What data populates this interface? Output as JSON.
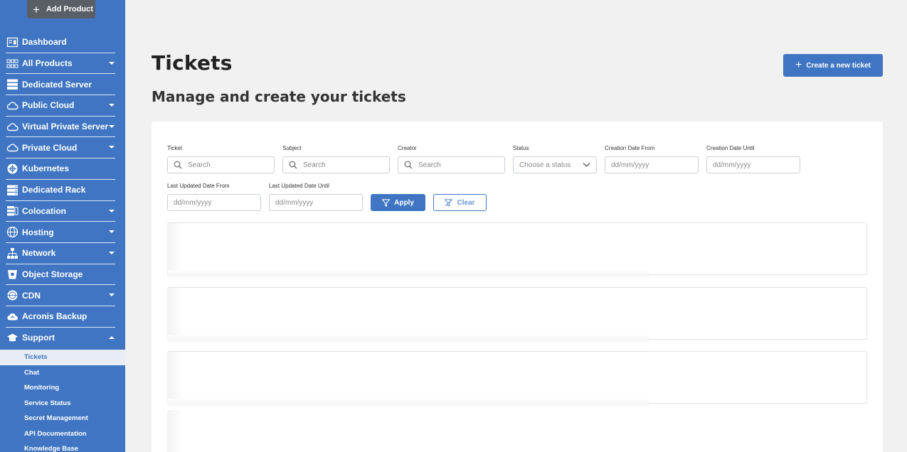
{
  "sidebar": {
    "add_product_label": "Add Product",
    "items": [
      {
        "label": "Dashboard",
        "icon": "dashboard-icon",
        "caret": "none"
      },
      {
        "label": "All Products",
        "icon": "grid-icon",
        "caret": "down"
      },
      {
        "label": "Dedicated Server",
        "icon": "server-icon",
        "caret": "none"
      },
      {
        "label": "Public Cloud",
        "icon": "cloud-icon",
        "caret": "down"
      },
      {
        "label": "Virtual Private Server",
        "icon": "cloud-icon",
        "caret": "down"
      },
      {
        "label": "Private Cloud",
        "icon": "cloud-icon",
        "caret": "down"
      },
      {
        "label": "Kubernetes",
        "icon": "kubernetes-icon",
        "caret": "none"
      },
      {
        "label": "Dedicated Rack",
        "icon": "rack-icon",
        "caret": "none"
      },
      {
        "label": "Colocation",
        "icon": "colocation-icon",
        "caret": "down"
      },
      {
        "label": "Hosting",
        "icon": "globe-icon",
        "caret": "down"
      },
      {
        "label": "Network",
        "icon": "network-icon",
        "caret": "down"
      },
      {
        "label": "Object Storage",
        "icon": "bucket-icon",
        "caret": "none"
      },
      {
        "label": "CDN",
        "icon": "cdn-icon",
        "caret": "down"
      },
      {
        "label": "Acronis Backup",
        "icon": "cloud-upload-icon",
        "caret": "none"
      },
      {
        "label": "Support",
        "icon": "graduation-cap-icon",
        "caret": "up"
      }
    ],
    "sub_items": [
      {
        "label": "Tickets",
        "active": true
      },
      {
        "label": "Chat"
      },
      {
        "label": "Monitoring"
      },
      {
        "label": "Service Status"
      },
      {
        "label": "Secret Management"
      },
      {
        "label": "API Documentation"
      },
      {
        "label": "Knowledge Base"
      }
    ]
  },
  "header": {
    "title": "Tickets",
    "subtitle": "Manage and create your tickets",
    "create_button": "Create a new ticket"
  },
  "filters": {
    "ticket": {
      "label": "Ticket",
      "placeholder": "Search"
    },
    "subject": {
      "label": "Subject",
      "placeholder": "Search"
    },
    "creator": {
      "label": "Creator",
      "placeholder": "Search"
    },
    "status": {
      "label": "Status",
      "placeholder": "Choose a status"
    },
    "creation_from": {
      "label": "Creation Date From",
      "placeholder": "dd/mm/yyyy"
    },
    "creation_until": {
      "label": "Creation Date Until",
      "placeholder": "dd/mm/yyyy"
    },
    "updated_from": {
      "label": "Last Updated Date From",
      "placeholder": "dd/mm/yyyy"
    },
    "updated_until": {
      "label": "Last Updated Date Until",
      "placeholder": "dd/mm/yyyy"
    },
    "apply_label": "Apply",
    "clear_label": "Clear"
  },
  "colors": {
    "primary": "#3f75c2",
    "sidebar_bg": "#3f75c2",
    "page_bg": "#f1f1f1"
  }
}
